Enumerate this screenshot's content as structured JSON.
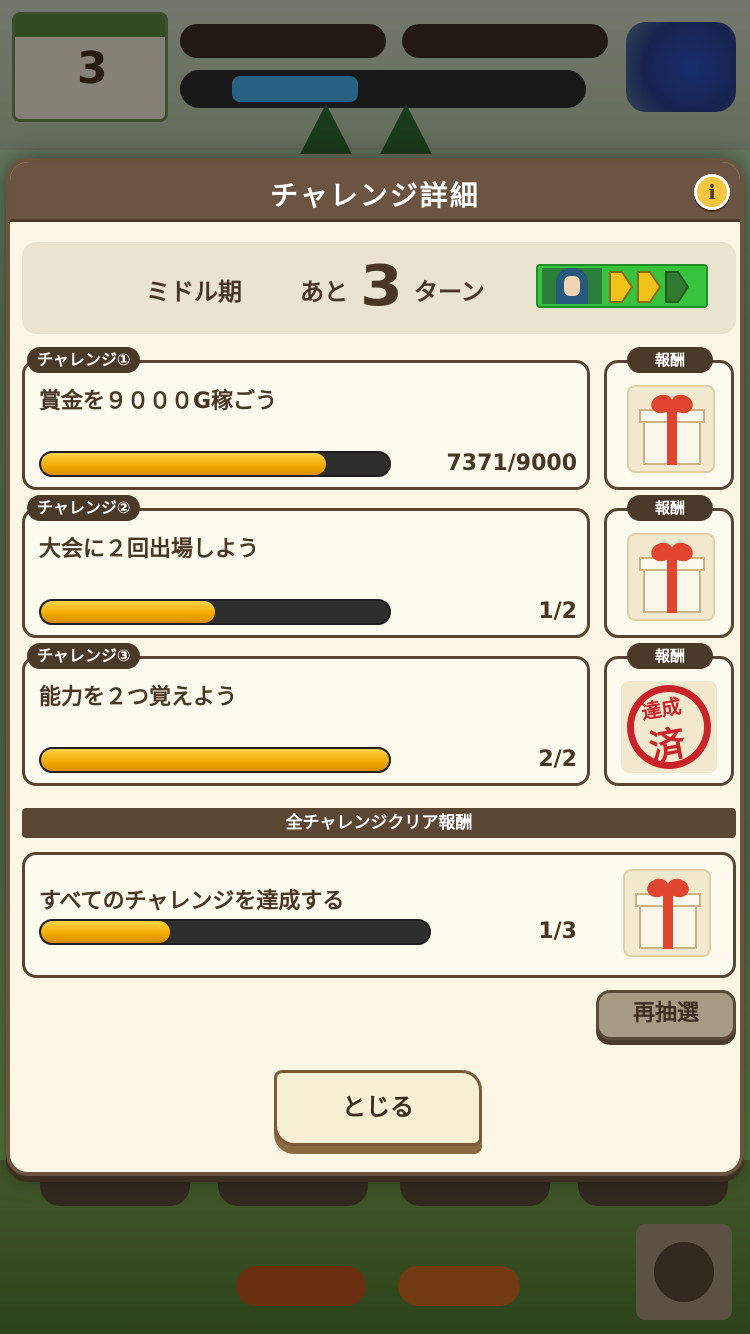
{
  "modal": {
    "title": "チャレンジ詳細",
    "info_icon": "i"
  },
  "turn_banner": {
    "period": "ミドル期",
    "remaining_prefix": "あと",
    "remaining_turns": "3",
    "remaining_suffix": "ターン"
  },
  "challenges": [
    {
      "tag": "チャレンジ①",
      "title": "賞金を９０００G稼ごう",
      "progress_text": "7371/9000",
      "current": 7371,
      "target": 9000,
      "reward_label": "報酬",
      "reward_state": "gift-icon"
    },
    {
      "tag": "チャレンジ②",
      "title": "大会に２回出場しよう",
      "progress_text": "1/2",
      "current": 1,
      "target": 2,
      "reward_label": "報酬",
      "reward_state": "gift-icon"
    },
    {
      "tag": "チャレンジ③",
      "title": "能力を２つ覚えよう",
      "progress_text": "2/2",
      "current": 2,
      "target": 2,
      "reward_label": "報酬",
      "reward_state": "achieved-stamp",
      "stamp_text_1": "達成",
      "stamp_text_2": "済"
    }
  ],
  "all_clear": {
    "header": "全チャレンジクリア報酬",
    "title": "すべてのチャレンジを達成する",
    "progress_text": "1/3",
    "current": 1,
    "target": 3
  },
  "buttons": {
    "redraw": "再抽選",
    "close": "とじる"
  },
  "colors": {
    "frame": "#6b5442",
    "panel": "#fbf7e4",
    "progress_fill": "#f2a800",
    "progress_track": "#2e2e2e",
    "stamp": "#c8242a",
    "chip_green": "#37c43c",
    "arrow_yellow": "#f2c21a"
  }
}
